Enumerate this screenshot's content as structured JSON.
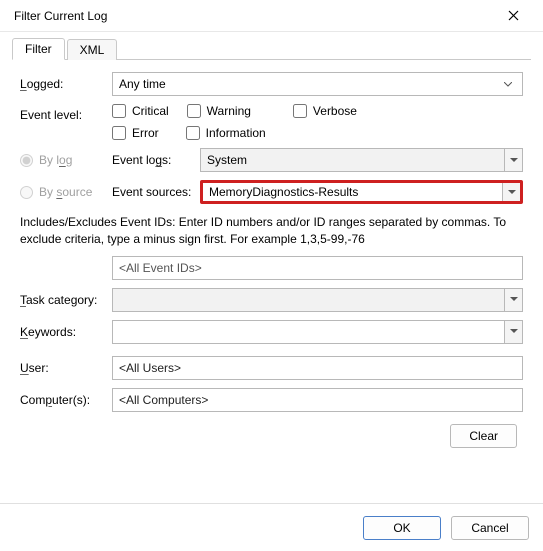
{
  "window": {
    "title": "Filter Current Log"
  },
  "tabs": {
    "filter": "Filter",
    "xml": "XML"
  },
  "labels": {
    "logged": "Logged:",
    "event_level": "Event level:",
    "by_log": "By log",
    "by_source": "By source",
    "event_logs": "Event logs:",
    "event_sources": "Event sources:",
    "task_category": "Task category:",
    "keywords": "Keywords:",
    "user": "User:",
    "computers": "Computer(s):"
  },
  "logged": {
    "value": "Any time"
  },
  "levels": {
    "critical": "Critical",
    "warning": "Warning",
    "verbose": "Verbose",
    "error": "Error",
    "information": "Information"
  },
  "event_logs": {
    "value": "System"
  },
  "event_sources": {
    "value": "MemoryDiagnostics-Results"
  },
  "help_text": "Includes/Excludes Event IDs: Enter ID numbers and/or ID ranges separated by commas. To exclude criteria, type a minus sign first. For example 1,3,5-99,-76",
  "event_ids": {
    "placeholder": "<All Event IDs>"
  },
  "user": {
    "placeholder": "<All Users>"
  },
  "computers": {
    "placeholder": "<All Computers>"
  },
  "buttons": {
    "clear": "Clear",
    "ok": "OK",
    "cancel": "Cancel"
  }
}
